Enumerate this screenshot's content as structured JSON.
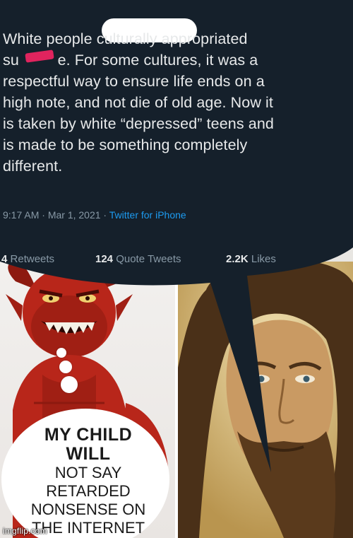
{
  "tweet": {
    "text": "White people culturally appropriated\nsu         e. For some cultures, it was a\nrespectful way to ensure life ends on a\nhigh note, and not die of old age. Now it\nis taken by white “depressed” teens and\nis made to be something completely\ndifferent.",
    "time": "9:17 AM",
    "separator1": " · ",
    "date": "Mar 1, 2021",
    "separator2": " · ",
    "source": "Twitter for iPhone",
    "retweets_label": "Retweets",
    "retweets_count": "4",
    "quote_count": "124",
    "quote_label": "Quote Tweets",
    "likes_count": "2.2K",
    "likes_label": "Likes"
  },
  "thought": {
    "line1": "MY CHILD",
    "line2": "WILL",
    "line3": "NOT SAY\nRETARDED\nNONSENSE ON\nTHE INTERNET"
  },
  "watermark": "imgflip.com",
  "colors": {
    "tweet_background": "#15202b",
    "tweet_text": "#e7e9ea",
    "meta_gray": "#8899a6",
    "link_blue": "#1d9bf0",
    "redaction_red": "#e0245e",
    "devil_red": "#b8261a"
  }
}
